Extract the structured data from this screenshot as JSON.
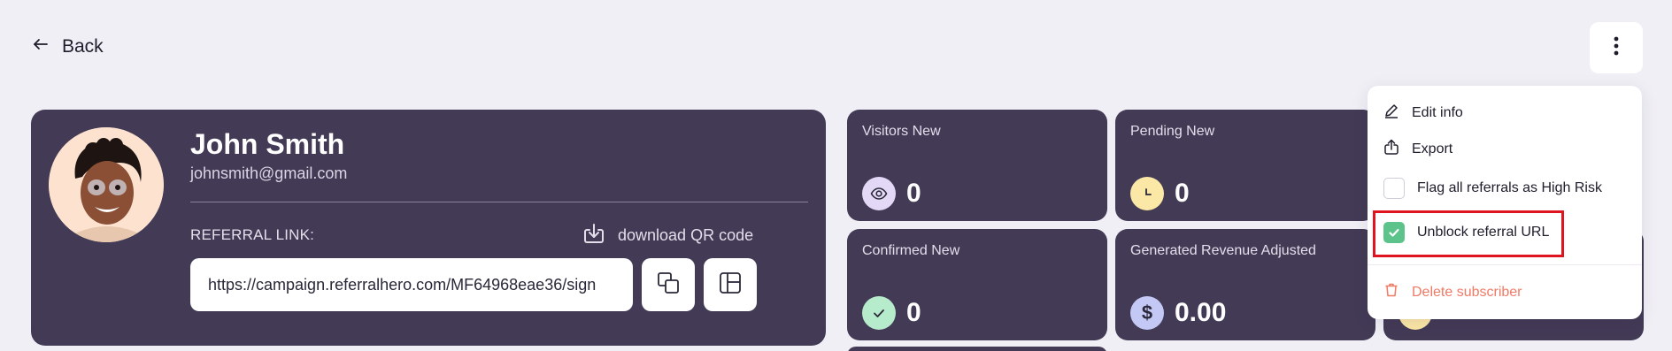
{
  "nav": {
    "back_label": "Back"
  },
  "profile": {
    "name": "John Smith",
    "email": "johnsmith@gmail.com",
    "referral_label": "REFERRAL LINK:",
    "qr_label": "download QR code",
    "referral_url": "https://campaign.referralhero.com/MF64968eae36/sign"
  },
  "stats": [
    {
      "label": "Visitors New",
      "value": "0",
      "icon": "eye-icon",
      "icon_bg": "#e3d9f7"
    },
    {
      "label": "Pending New",
      "value": "0",
      "icon": "clock-icon",
      "icon_bg": "#fbe7a6"
    },
    {
      "label": "Confirmed New",
      "value": "0",
      "icon": "check-icon",
      "icon_bg": "#b6ebcb"
    },
    {
      "label": "Generated Revenue Adjusted",
      "value": "0.00",
      "icon": "dollar-icon",
      "icon_bg": "#c3c8f5"
    }
  ],
  "menu": {
    "edit_info": "Edit info",
    "export": "Export",
    "flag_high_risk": "Flag all referrals as High Risk",
    "flag_high_risk_checked": false,
    "unblock_url": "Unblock referral URL",
    "unblock_url_checked": true,
    "delete_subscriber": "Delete subscriber"
  },
  "colors": {
    "card_bg": "#433a56",
    "page_bg": "#f0eff5",
    "danger": "#f07a66",
    "success": "#5cc48a",
    "highlight": "#e0141e"
  }
}
